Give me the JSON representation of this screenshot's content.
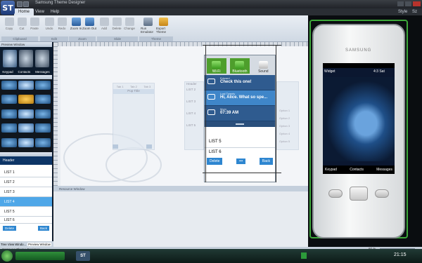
{
  "app": {
    "logo": "ST",
    "title": "Samsung Theme Designer",
    "status": "Samsung Theme Designer",
    "right_menu": [
      "Style",
      "Sz"
    ]
  },
  "ribbon": {
    "tabs": [
      "Home",
      "View",
      "Help"
    ],
    "buttons": [
      "Copy",
      "Cut",
      "Paste",
      "Undo",
      "Redo",
      "Zoom In",
      "Zoom Out",
      "Add",
      "Delete",
      "Change",
      "Run Emulator",
      "Export Theme"
    ],
    "groups": [
      "Clipboard",
      "Edit",
      "Zoom",
      "Slide",
      "Theme"
    ]
  },
  "left": {
    "preview_title": "Preview Window",
    "preview_tabs": [
      "Keypad",
      "Contacts",
      "Messages"
    ],
    "list_header": "Header",
    "list_items": [
      "LIST 1",
      "LIST 2",
      "LIST 3",
      "LIST 4",
      "LIST 5",
      "LIST 6"
    ],
    "buttons": [
      "Delete",
      "Back"
    ],
    "bottom_tabs": [
      "Tree View Windo...",
      "Preview Window"
    ]
  },
  "workspace": {
    "ghost_tabs": [
      "Tab 1",
      "Tab 2",
      "Tab 3"
    ],
    "ghost_title": "Pop Title",
    "ghost_lists": [
      "LIST 2",
      "LIST 3",
      "LIST 4",
      "LIST 5"
    ],
    "ghost_opts": [
      "Option 1",
      "Option 2",
      "Option 3",
      "Option 4",
      "Option 5"
    ],
    "ghost_header": "Header",
    "resource_window": "Resource Window"
  },
  "notification": {
    "quick": [
      "Wi-Fi",
      "Bluetooth",
      "Sound"
    ],
    "items": [
      {
        "title": "Edward",
        "text": "Check this one!"
      },
      {
        "title": "Lost Twenty",
        "text": "Hi, Alice. What so spe..."
      },
      {
        "title": "Mom",
        "text": "07:39 AM"
      }
    ],
    "list_items": [
      "LIST 5",
      "LIST 6"
    ],
    "buttons": [
      "Delete",
      "Back"
    ]
  },
  "phone": {
    "brand": "SAMSUNG",
    "widget": "Widget",
    "clock": "4:3 Sat",
    "softkeys": [
      "Keypad",
      "Contacts",
      "Messages"
    ]
  },
  "bottom": {
    "zoom": "60 %",
    "time": "21:15",
    "taskbar_app": "ST"
  }
}
